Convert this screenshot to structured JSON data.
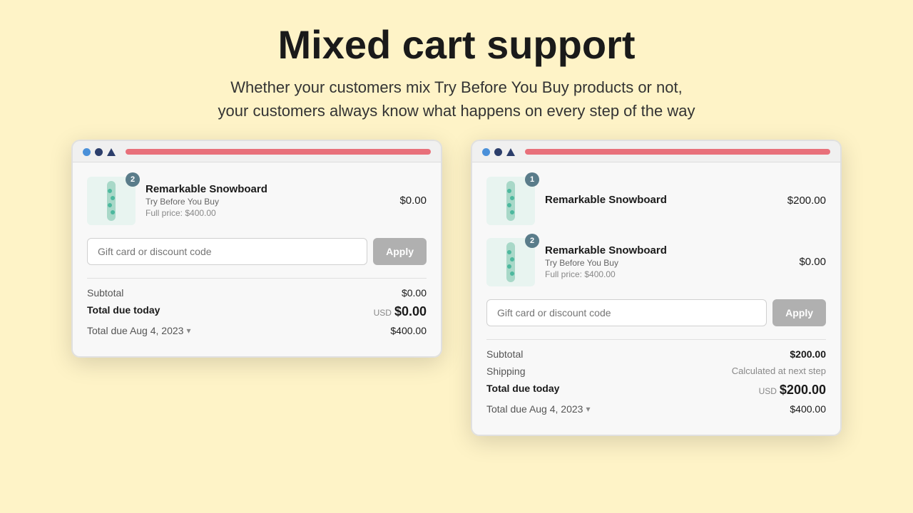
{
  "page": {
    "title": "Mixed cart support",
    "subtitle_line1": "Whether your customers mix Try Before You Buy products or not,",
    "subtitle_line2": "your customers always know what happens on every step of the way"
  },
  "cart_left": {
    "items": [
      {
        "name": "Remarkable Snowboard",
        "badge": "2",
        "tag": "Try Before You Buy",
        "full_price": "Full price: $400.00",
        "price": "$0.00"
      }
    ],
    "discount_placeholder": "Gift card or discount code",
    "apply_label": "Apply",
    "subtotal_label": "Subtotal",
    "subtotal_value": "$0.00",
    "total_label": "Total due today",
    "total_currency": "USD",
    "total_value": "$0.00",
    "future_label": "Total due Aug 4, 2023",
    "future_value": "$400.00"
  },
  "cart_right": {
    "items": [
      {
        "name": "Remarkable Snowboard",
        "badge": "1",
        "tag": null,
        "full_price": null,
        "price": "$200.00"
      },
      {
        "name": "Remarkable Snowboard",
        "badge": "2",
        "tag": "Try Before You Buy",
        "full_price": "Full price: $400.00",
        "price": "$0.00"
      }
    ],
    "discount_placeholder": "Gift card or discount code",
    "apply_label": "Apply",
    "subtotal_label": "Subtotal",
    "subtotal_value": "$200.00",
    "shipping_label": "Shipping",
    "shipping_value": "Calculated at next step",
    "total_label": "Total due today",
    "total_currency": "USD",
    "total_value": "$200.00",
    "future_label": "Total due Aug 4, 2023",
    "future_value": "$400.00"
  }
}
